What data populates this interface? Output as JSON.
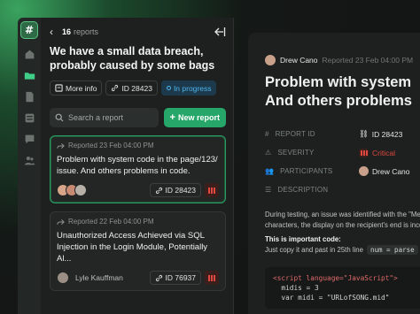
{
  "rail": {
    "logo": "#",
    "icons": [
      "home-icon",
      "folder-icon",
      "file-icon",
      "list-icon",
      "chat-icon",
      "users-icon"
    ]
  },
  "list": {
    "back": "‹",
    "count_number": "16",
    "count_label": "reports",
    "subject": "We have a small data breach, probably caused by some bags or id...",
    "chips": {
      "more_info": "More info",
      "id": "ID 28423",
      "status": "In progress"
    },
    "search_placeholder": "Search a report",
    "new_report": "New report",
    "cards": [
      {
        "meta": "Reported 23 Feb 04:00 PM",
        "text": "Problem with system code in the page/123/ issue. And others problems in code.",
        "id": "ID 28423"
      },
      {
        "meta": "Reported 22 Feb 04:00 PM",
        "text": "Unauthorized Access Achieved via SQL Injection in the Login Module, Potentially Al...",
        "author": "Lyle Kauffman",
        "id": "ID 76937"
      }
    ]
  },
  "detail": {
    "author": "Drew Cano",
    "date": "Reported 23 Feb 04:00 PM",
    "title_line1": "Problem with system",
    "title_line2": "And others problems",
    "props": {
      "report_id_label": "REPORT ID",
      "report_id_value": "ID 28423",
      "severity_label": "SEVERITY",
      "severity_value": "Critical",
      "participants_label": "PARTICIPANTS",
      "participants_value": "Drew Cano",
      "description_label": "DESCRIPTION"
    },
    "desc_line1": "During testing, an issue was identified with the \"Me",
    "desc_line2": "characters, the display on the recipient's end is incorr",
    "important": "This is important code:",
    "copy_line": "Just copy it and past in 25th line",
    "inline_code": "num = parse",
    "code_lines": [
      "<script language=\"JavaScript\">",
      "  midis = 3",
      "  var midi = \"URLofSONG.mid\""
    ]
  },
  "colors": {
    "accent": "#27a66a",
    "status_blue": "#4fb4f0",
    "critical": "#e0483f"
  }
}
